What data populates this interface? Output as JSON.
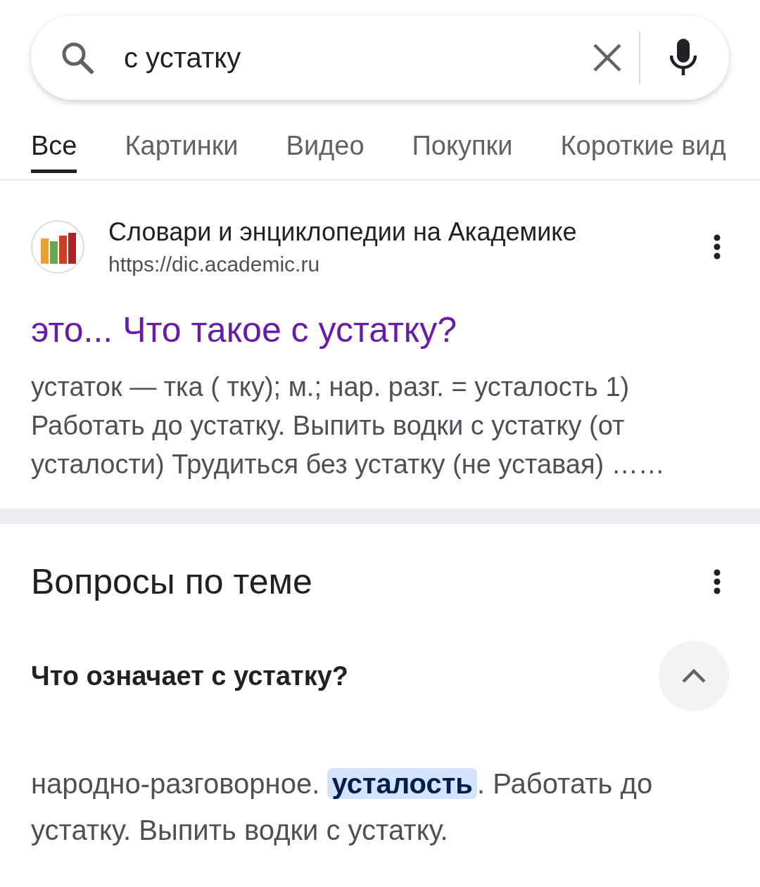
{
  "search": {
    "value": "с устатку"
  },
  "tabs": [
    {
      "label": "Все",
      "selected": true
    },
    {
      "label": "Картинки",
      "selected": false
    },
    {
      "label": "Видео",
      "selected": false
    },
    {
      "label": "Покупки",
      "selected": false
    },
    {
      "label": "Короткие вид",
      "selected": false
    }
  ],
  "result": {
    "site_name": "Словари и энциклопедии на Академике",
    "url": "https://dic.academic.ru",
    "title": "это... Что такое с устатку?",
    "visited": true,
    "snippet": "устаток — тка ( тку); м.; нар. разг. = усталость 1) Работать до устатку. Выпить водки с устатку (от усталости) Трудиться без устатку (не уставая) ……"
  },
  "related": {
    "heading": "Вопросы по теме",
    "questions": [
      {
        "question": "Что означает с устатку?",
        "expanded": true,
        "answer": "народно-разговорное. **усталость**. Работать до устатку. Выпить водки с устатку."
      }
    ]
  }
}
